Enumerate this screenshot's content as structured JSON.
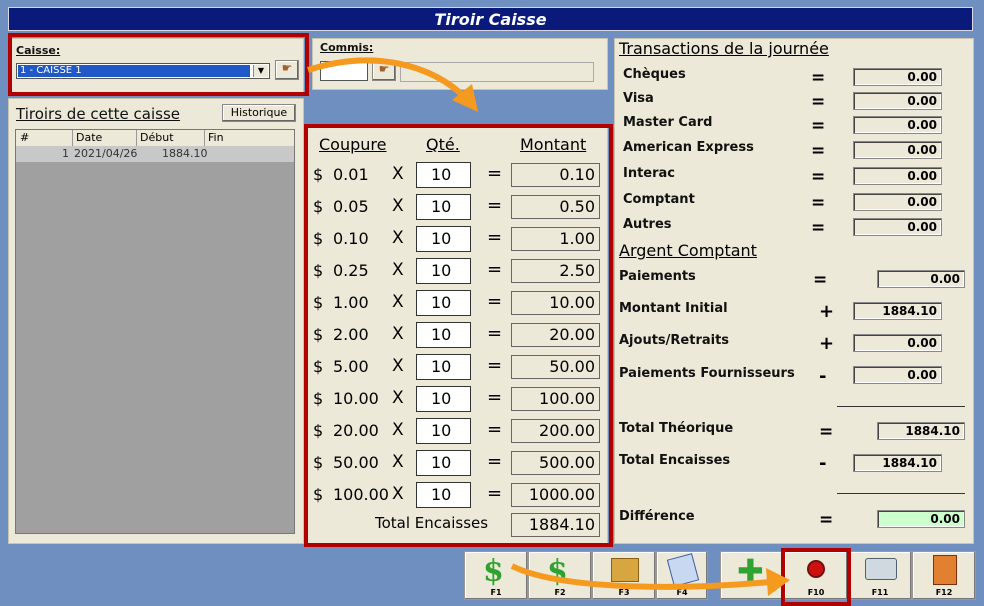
{
  "title": "Tiroir Caisse",
  "caisse": {
    "label": "Caisse:",
    "selected": "1 - CAISSE 1"
  },
  "commis": {
    "label": "Commis:",
    "value": ""
  },
  "tiroirs": {
    "title": "Tiroirs de cette caisse",
    "history_button": "Historique",
    "columns": [
      "#",
      "Date",
      "Début",
      "Fin"
    ],
    "rows": [
      {
        "num": "1",
        "date": "2021/04/26",
        "debut": "1884.10",
        "fin": ""
      }
    ]
  },
  "denom": {
    "headers": {
      "coupure": "Coupure",
      "qte": "Qté.",
      "montant": "Montant"
    },
    "rows": [
      {
        "cur": "$",
        "coupure": "0.01",
        "x": "X",
        "qte": "10",
        "eq": "=",
        "montant": "0.10"
      },
      {
        "cur": "$",
        "coupure": "0.05",
        "x": "X",
        "qte": "10",
        "eq": "=",
        "montant": "0.50"
      },
      {
        "cur": "$",
        "coupure": "0.10",
        "x": "X",
        "qte": "10",
        "eq": "=",
        "montant": "1.00"
      },
      {
        "cur": "$",
        "coupure": "0.25",
        "x": "X",
        "qte": "10",
        "eq": "=",
        "montant": "2.50"
      },
      {
        "cur": "$",
        "coupure": "1.00",
        "x": "X",
        "qte": "10",
        "eq": "=",
        "montant": "10.00"
      },
      {
        "cur": "$",
        "coupure": "2.00",
        "x": "X",
        "qte": "10",
        "eq": "=",
        "montant": "20.00"
      },
      {
        "cur": "$",
        "coupure": "5.00",
        "x": "X",
        "qte": "10",
        "eq": "=",
        "montant": "50.00"
      },
      {
        "cur": "$",
        "coupure": "10.00",
        "x": "X",
        "qte": "10",
        "eq": "=",
        "montant": "100.00"
      },
      {
        "cur": "$",
        "coupure": "20.00",
        "x": "X",
        "qte": "10",
        "eq": "=",
        "montant": "200.00"
      },
      {
        "cur": "$",
        "coupure": "50.00",
        "x": "X",
        "qte": "10",
        "eq": "=",
        "montant": "500.00"
      },
      {
        "cur": "$",
        "coupure": "100.00",
        "x": "X",
        "qte": "10",
        "eq": "=",
        "montant": "1000.00"
      }
    ],
    "total_label": "Total Encaisses",
    "total_value": "1884.10"
  },
  "transactions": {
    "title": "Transactions de la journée",
    "rows": [
      {
        "label": "Chèques",
        "op": "=",
        "value": "0.00"
      },
      {
        "label": "Visa",
        "op": "=",
        "value": "0.00"
      },
      {
        "label": "Master Card",
        "op": "=",
        "value": "0.00"
      },
      {
        "label": "American Express",
        "op": "=",
        "value": "0.00"
      },
      {
        "label": "Interac",
        "op": "=",
        "value": "0.00"
      },
      {
        "label": "Comptant",
        "op": "=",
        "value": "0.00"
      },
      {
        "label": "Autres",
        "op": "=",
        "value": "0.00"
      }
    ]
  },
  "argent": {
    "title": "Argent Comptant",
    "paiements": {
      "label": "Paiements",
      "op": "=",
      "value": "0.00"
    },
    "montant_initial": {
      "label": "Montant Initial",
      "op": "+",
      "value": "1884.10"
    },
    "ajouts": {
      "label": "Ajouts/Retraits",
      "op": "+",
      "value": "0.00"
    },
    "fournisseurs": {
      "label": "Paiements Fournisseurs",
      "op": "-",
      "value": "0.00"
    },
    "total_theorique": {
      "label": "Total Théorique",
      "op": "=",
      "value": "1884.10"
    },
    "total_encaisses": {
      "label": "Total Encaisses",
      "op": "-",
      "value": "1884.10"
    },
    "difference": {
      "label": "Différence",
      "op": "=",
      "value": "0.00"
    }
  },
  "fkeys": [
    "F1",
    "F2",
    "F3",
    "F4",
    "F10",
    "F11",
    "F12"
  ],
  "colors": {
    "title_bg": "#0a1a7a",
    "highlight": "#b00000",
    "arrow": "#f59a1e",
    "diff_bg": "#ccffcc"
  }
}
